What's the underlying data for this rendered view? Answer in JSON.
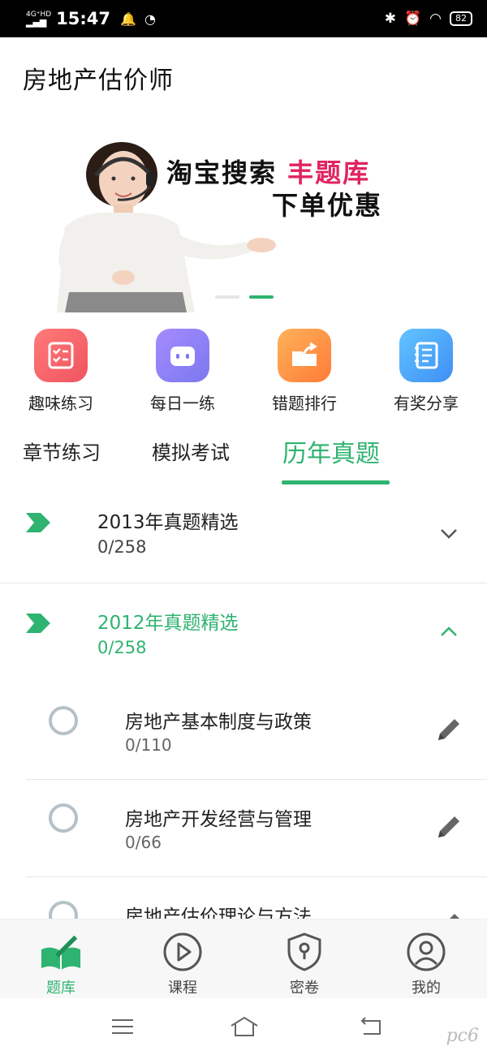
{
  "status_bar": {
    "network_top": "4G⁺HD",
    "network_bottom": "▂▄▆",
    "time": "15:47",
    "battery": "82",
    "icons": [
      "bell-icon",
      "clock-icon",
      "bluetooth-icon",
      "alarm-icon",
      "wifi-icon"
    ]
  },
  "header": {
    "title": "房地产估价师"
  },
  "banner": {
    "line1_prefix": "淘宝搜索 ",
    "line1_highlight": "丰题库",
    "line2": "下单优惠",
    "highlight_color": "#e0245e"
  },
  "quick_actions": [
    {
      "label": "趣味练习",
      "icon": "checklist-icon"
    },
    {
      "label": "每日一练",
      "icon": "robot-icon"
    },
    {
      "label": "错题排行",
      "icon": "folder-export-icon"
    },
    {
      "label": "有奖分享",
      "icon": "notebook-icon"
    }
  ],
  "tabs": [
    {
      "label": "章节练习",
      "active": false
    },
    {
      "label": "模拟考试",
      "active": false
    },
    {
      "label": "历年真题",
      "active": true
    }
  ],
  "groups": [
    {
      "title": "2013年真题精选",
      "count": "0/258",
      "expanded": false
    },
    {
      "title": "2012年真题精选",
      "count": "0/258",
      "expanded": true
    }
  ],
  "sub_items": [
    {
      "title": "房地产基本制度与政策",
      "count": "0/110"
    },
    {
      "title": "房地产开发经营与管理",
      "count": "0/66"
    },
    {
      "title": "房地产估价理论与方法",
      "count": ""
    }
  ],
  "bottom_nav": [
    {
      "label": "题库",
      "icon": "book-pen-icon",
      "active": true
    },
    {
      "label": "课程",
      "icon": "play-circle-icon",
      "active": false
    },
    {
      "label": "密卷",
      "icon": "shield-lock-icon",
      "active": false
    },
    {
      "label": "我的",
      "icon": "user-icon",
      "active": false
    }
  ],
  "watermark": "pc6",
  "accent_color": "#2fb370"
}
